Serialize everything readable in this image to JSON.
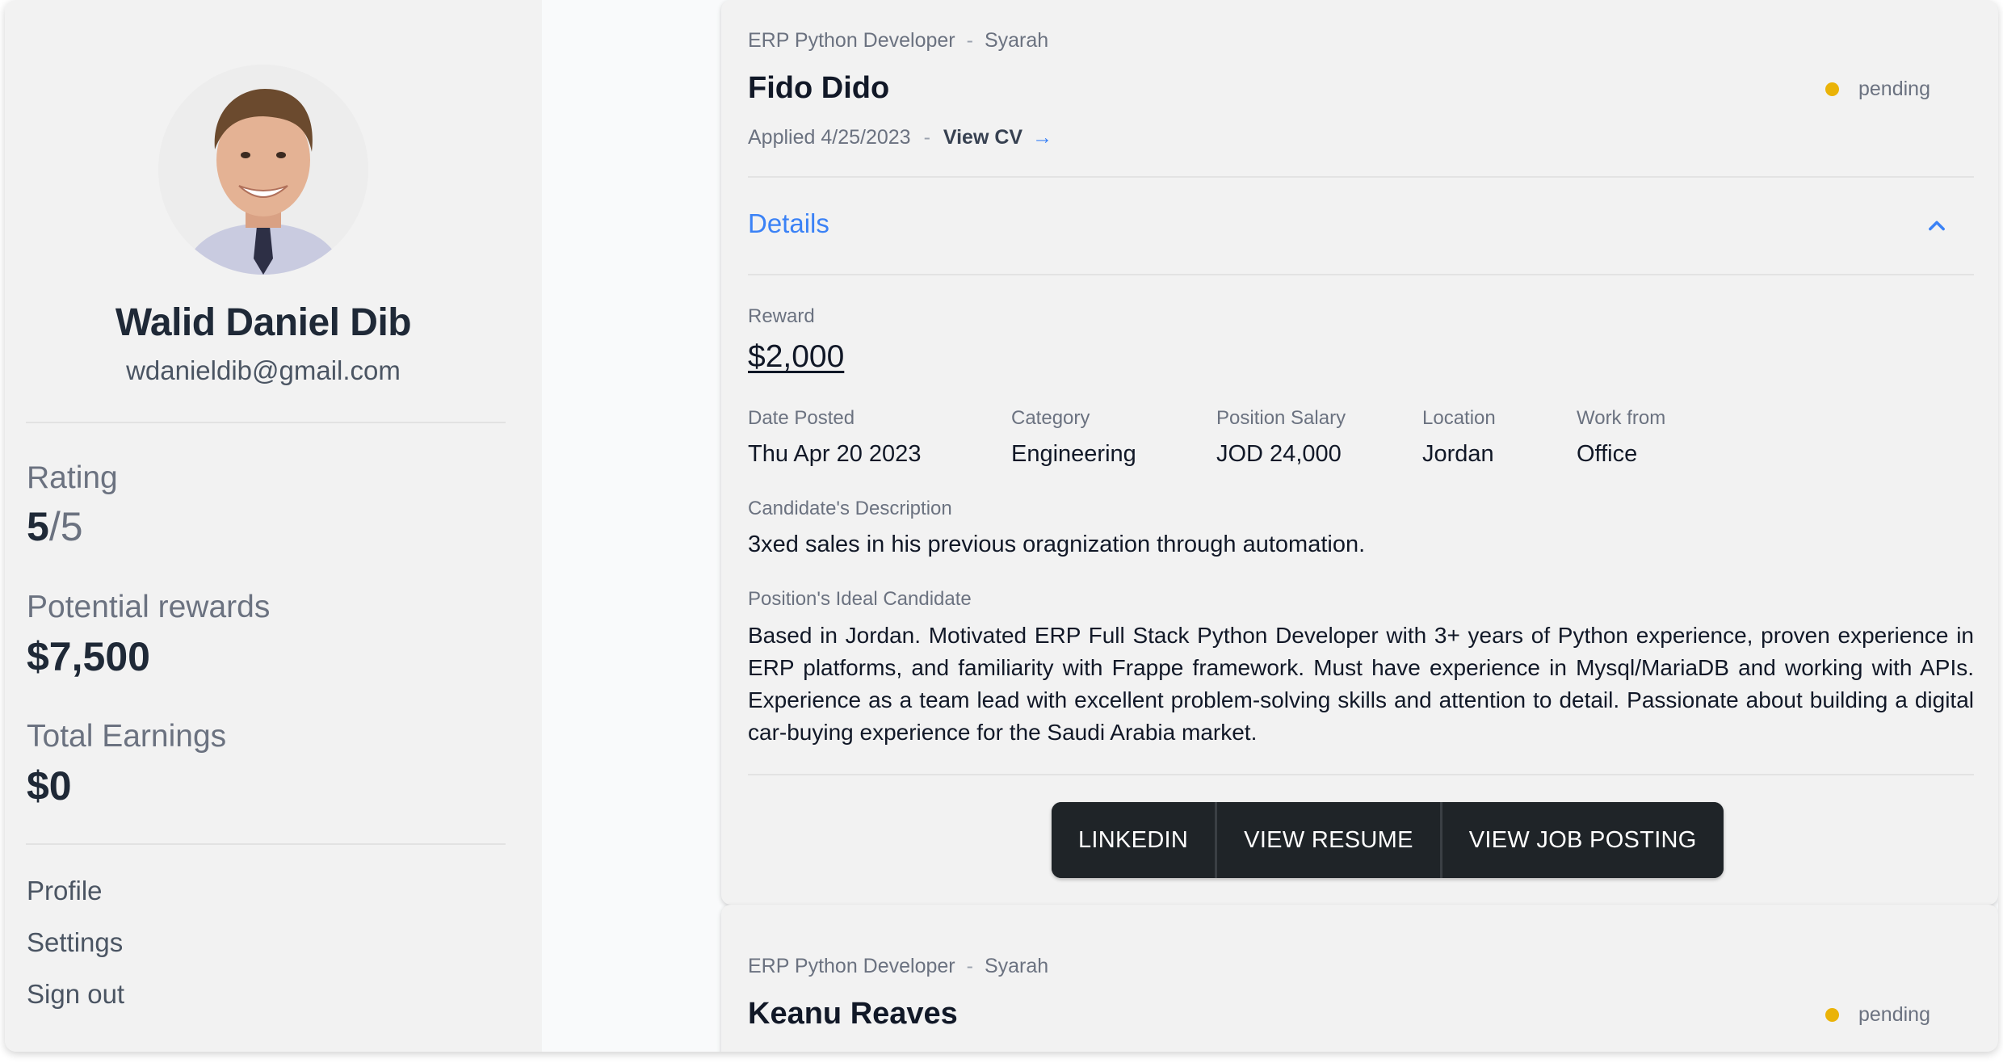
{
  "sidebar": {
    "name": "Walid Daniel Dib",
    "email": "wdanieldib@gmail.com",
    "rating_label": "Rating",
    "rating_value": "5",
    "rating_suffix": "/5",
    "rewards_label": "Potential rewards",
    "rewards_value": "$7,500",
    "earnings_label": "Total Earnings",
    "earnings_value": "$0",
    "links": [
      "Profile",
      "Settings",
      "Sign out"
    ]
  },
  "applications": [
    {
      "job_title": "ERP Python Developer",
      "company": "Syarah",
      "meta_separator": "-",
      "candidate_name": "Fido Dido",
      "status": "pending",
      "status_color": "#eab308",
      "applied_text": "Applied 4/25/2023",
      "view_cv_label": "View CV",
      "details_label": "Details",
      "reward_label": "Reward",
      "reward_value": "$2,000",
      "fields": [
        {
          "label": "Date Posted",
          "value": "Thu Apr 20 2023"
        },
        {
          "label": "Category",
          "value": "Engineering"
        },
        {
          "label": "Position Salary",
          "value": "JOD 24,000"
        },
        {
          "label": "Location",
          "value": "Jordan"
        },
        {
          "label": "Work from",
          "value": "Office"
        }
      ],
      "candidate_desc_label": "Candidate's Description",
      "candidate_desc": "3xed sales in his previous oragnization through automation.",
      "ideal_label": "Position's Ideal Candidate",
      "ideal_text": "Based in Jordan. Motivated ERP Full Stack Python Developer with 3+ years of Python experience, proven experience in ERP platforms, and familiarity with Frappe framework. Must have experience in Mysql/MariaDB and working with APIs. Experience as a team lead with excellent problem-solving skills and attention to detail. Passionate about building a digital car-buying experience for the Saudi Arabia market.",
      "buttons": [
        "LINKEDIN",
        "VIEW RESUME",
        "VIEW JOB POSTING"
      ]
    },
    {
      "job_title": "ERP Python Developer",
      "company": "Syarah",
      "meta_separator": "-",
      "candidate_name": "Keanu Reaves",
      "status": "pending",
      "status_color": "#eab308"
    }
  ],
  "icons": {
    "view_cv_arrow": "arrow-right-icon",
    "details_chevron": "chevron-up-icon",
    "avatar": "avatar"
  },
  "colors": {
    "accent": "#3b82f6",
    "button_dark": "#1f2428",
    "pending_dot": "#eab308"
  }
}
